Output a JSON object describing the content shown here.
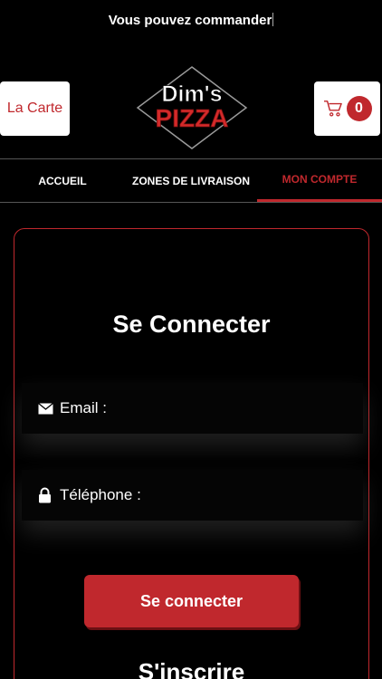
{
  "banner": {
    "text": "Vous pouvez commander"
  },
  "header": {
    "menu_label": "La Carte",
    "logo_line1": "Dim's",
    "logo_line2": "PIZZA",
    "cart_count": "0"
  },
  "nav": {
    "items": [
      {
        "label": "ACCUEIL"
      },
      {
        "label": "ZONES DE LIVRAISON"
      },
      {
        "label": "MON COMPTE"
      }
    ],
    "active_index": 2
  },
  "login": {
    "title": "Se Connecter",
    "email_label": "Email :",
    "phone_label": "Téléphone :",
    "submit_label": "Se connecter"
  },
  "register": {
    "title": "S'inscrire"
  },
  "colors": {
    "accent": "#c0282d",
    "background": "#000000",
    "button_text": "#ffffff"
  },
  "icons": {
    "email": "envelope-icon",
    "phone": "lock-icon",
    "cart": "shopping-cart-icon"
  }
}
